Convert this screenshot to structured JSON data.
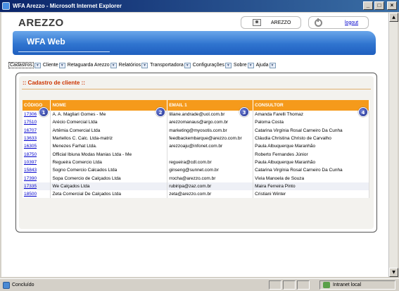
{
  "window": {
    "title": "WFA Arezzo - Microsoft Internet Explorer",
    "min": "_",
    "max": "□",
    "close": "×"
  },
  "header": {
    "logo": "AREZZO",
    "user_name": "AREZZO",
    "logout_label": "logout"
  },
  "banner": {
    "title": "WFA Web"
  },
  "menu": {
    "items": [
      {
        "label": "Cadastros"
      },
      {
        "label": "Cliente"
      },
      {
        "label": "Retaguarda Arezzo"
      },
      {
        "label": "Relatórios"
      },
      {
        "label": "Transportadora"
      },
      {
        "label": "Configurações"
      },
      {
        "label": "Sobre"
      },
      {
        "label": "Ajuda"
      }
    ]
  },
  "panel": {
    "title": ":: Cadastro de cliente ::"
  },
  "table": {
    "headers": [
      "CÓDIGO",
      "NOME",
      "EMAIL 1",
      "CONSULTOR"
    ],
    "rows": [
      [
        "17306",
        "A. A. Magliari Gomes - Me",
        "liliane.andrade@uol.com.br",
        "Amanda Farelli Thomaz"
      ],
      [
        "17510",
        "Arécio Comercial Ltda",
        "arezzomanaus@argo.com.br",
        "Paloma Costa"
      ],
      [
        "16707",
        "Artêmia Comercial Ltda",
        "marketing@myosotis.com.br",
        "Catarina Virgínia Rosal Carneiro Da Cunha"
      ],
      [
        "13633",
        "Martellos C. Calc. Ltda-matriz",
        "feedbackembarque@arezzo.com.br",
        "Cláudia Christina Christo de Carvalho"
      ],
      [
        "16305",
        "Menezes Farhat Ltda.",
        "arezzoaju@infonet.com.br",
        "Paula Albuquerque Maranhão"
      ],
      [
        "18750",
        "Official Ibiuna Modas Manias Ltda - Me",
        "",
        "Roberto Fernandes Júnior"
      ],
      [
        "10397",
        "Regueira Comercio Ltda",
        "regueira@cdl.com.br",
        "Paula Albuquerque Maranhão"
      ],
      [
        "15843",
        "Sogno Comercio Calcados Ltda",
        "ginseng@sunnet.com.br",
        "Catarina Virgínia Rosal Carneiro Da Cunha"
      ],
      [
        "17390",
        "Sopa Comercio de Calçados Ltda",
        "rrocha@arezzo.com.br",
        "Vivia Manoela de Souza"
      ],
      [
        "17335",
        "We Calçados Ltda",
        "rubiripa@zaz.com.br",
        "Maira Ferreira Pinto"
      ],
      [
        "18500",
        "Zeta Comercial De Calçados Ltda",
        "zeta@arezzo.com.br",
        "Cristiani Winter"
      ]
    ]
  },
  "markers": [
    "1",
    "2",
    "3",
    "4"
  ],
  "statusbar": {
    "status": "Concluído",
    "zone": "Intranet local"
  }
}
